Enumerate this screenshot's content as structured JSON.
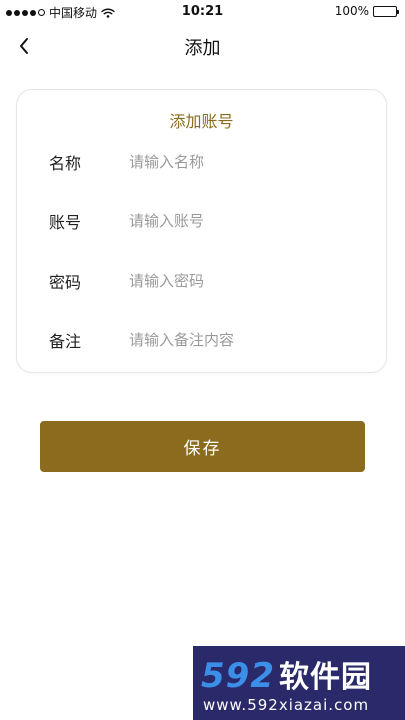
{
  "status_bar": {
    "carrier": "中国移动",
    "time": "10:21",
    "battery_text": "100%",
    "battery_level": 1.0,
    "icons": [
      "signal-dots-icon",
      "wifi-icon",
      "battery-icon"
    ]
  },
  "nav": {
    "back_icon": "chevron-left-icon",
    "title": "添加"
  },
  "form": {
    "title": "添加账号",
    "fields": [
      {
        "label": "名称",
        "placeholder": "请输入名称",
        "value": ""
      },
      {
        "label": "账号",
        "placeholder": "请输入账号",
        "value": ""
      },
      {
        "label": "密码",
        "placeholder": "请输入密码",
        "value": ""
      },
      {
        "label": "备注",
        "placeholder": "请输入备注内容",
        "value": ""
      }
    ]
  },
  "save_button": {
    "label": "保存"
  },
  "watermark": {
    "logo_number": "592",
    "logo_text": "软件园",
    "url": "www.592xiazai.com"
  },
  "colors": {
    "accent": "#8b6b1e",
    "card_border": "#e6e6e6",
    "placeholder": "#9a9a9a",
    "watermark_bg": "#2a2a6a",
    "watermark_logo": "#3b8fe8"
  }
}
